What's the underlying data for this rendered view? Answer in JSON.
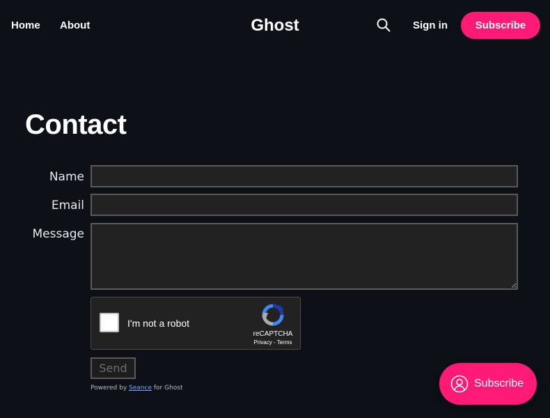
{
  "header": {
    "nav": [
      {
        "label": "Home"
      },
      {
        "label": "About"
      }
    ],
    "site_title": "Ghost",
    "search_icon": "search-icon",
    "signin_label": "Sign in",
    "subscribe_label": "Subscribe"
  },
  "page": {
    "title": "Contact"
  },
  "form": {
    "name_label": "Name",
    "name_value": "",
    "email_label": "Email",
    "email_value": "",
    "message_label": "Message",
    "message_value": "",
    "recaptcha": {
      "checkbox_label": "I'm not a robot",
      "brand": "reCAPTCHA",
      "privacy": "Privacy",
      "separator": " - ",
      "terms": "Terms"
    },
    "send_label": "Send",
    "powered_prefix": "Powered by ",
    "powered_link": "Seance",
    "powered_suffix": " for Ghost"
  },
  "portal": {
    "icon": "user-circle-icon",
    "label": "Subscribe"
  },
  "colors": {
    "background": "#0d1017",
    "accent": "#ff1a75",
    "field_bg": "#222222",
    "field_border": "#5a5a5a",
    "link": "#7aa6ff"
  }
}
